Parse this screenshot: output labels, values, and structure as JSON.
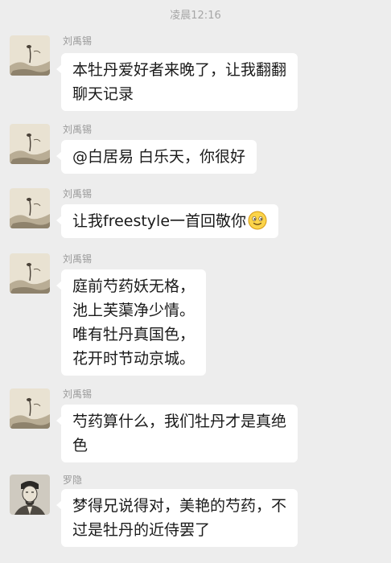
{
  "status": {
    "time": "凌晨12:16"
  },
  "messages": [
    {
      "sender": "刘禹锡",
      "avatar": "landscape-painting-avatar",
      "lines": [
        "本牡丹爱好者来晚了，让我翻翻",
        "聊天记录"
      ]
    },
    {
      "sender": "刘禹锡",
      "avatar": "landscape-painting-avatar",
      "lines": [
        "@白居易 白乐天，你很好"
      ]
    },
    {
      "sender": "刘禹锡",
      "avatar": "landscape-painting-avatar",
      "lines": [
        "让我freestyle一首回敬你"
      ],
      "emoji": "smiling-face-emoji"
    },
    {
      "sender": "刘禹锡",
      "avatar": "landscape-painting-avatar",
      "lines": [
        "庭前芍药妖无格，",
        "池上芙蕖净少情。",
        "唯有牡丹真国色，",
        "花开时节动京城。"
      ]
    },
    {
      "sender": "刘禹锡",
      "avatar": "landscape-painting-avatar",
      "lines": [
        "芍药算什么，我们牡丹才是真绝",
        "色"
      ]
    },
    {
      "sender": "罗隐",
      "avatar": "ink-portrait-avatar",
      "lines": [
        "梦得兄说得对，美艳的芍药，不",
        "过是牡丹的近侍罢了"
      ]
    }
  ]
}
